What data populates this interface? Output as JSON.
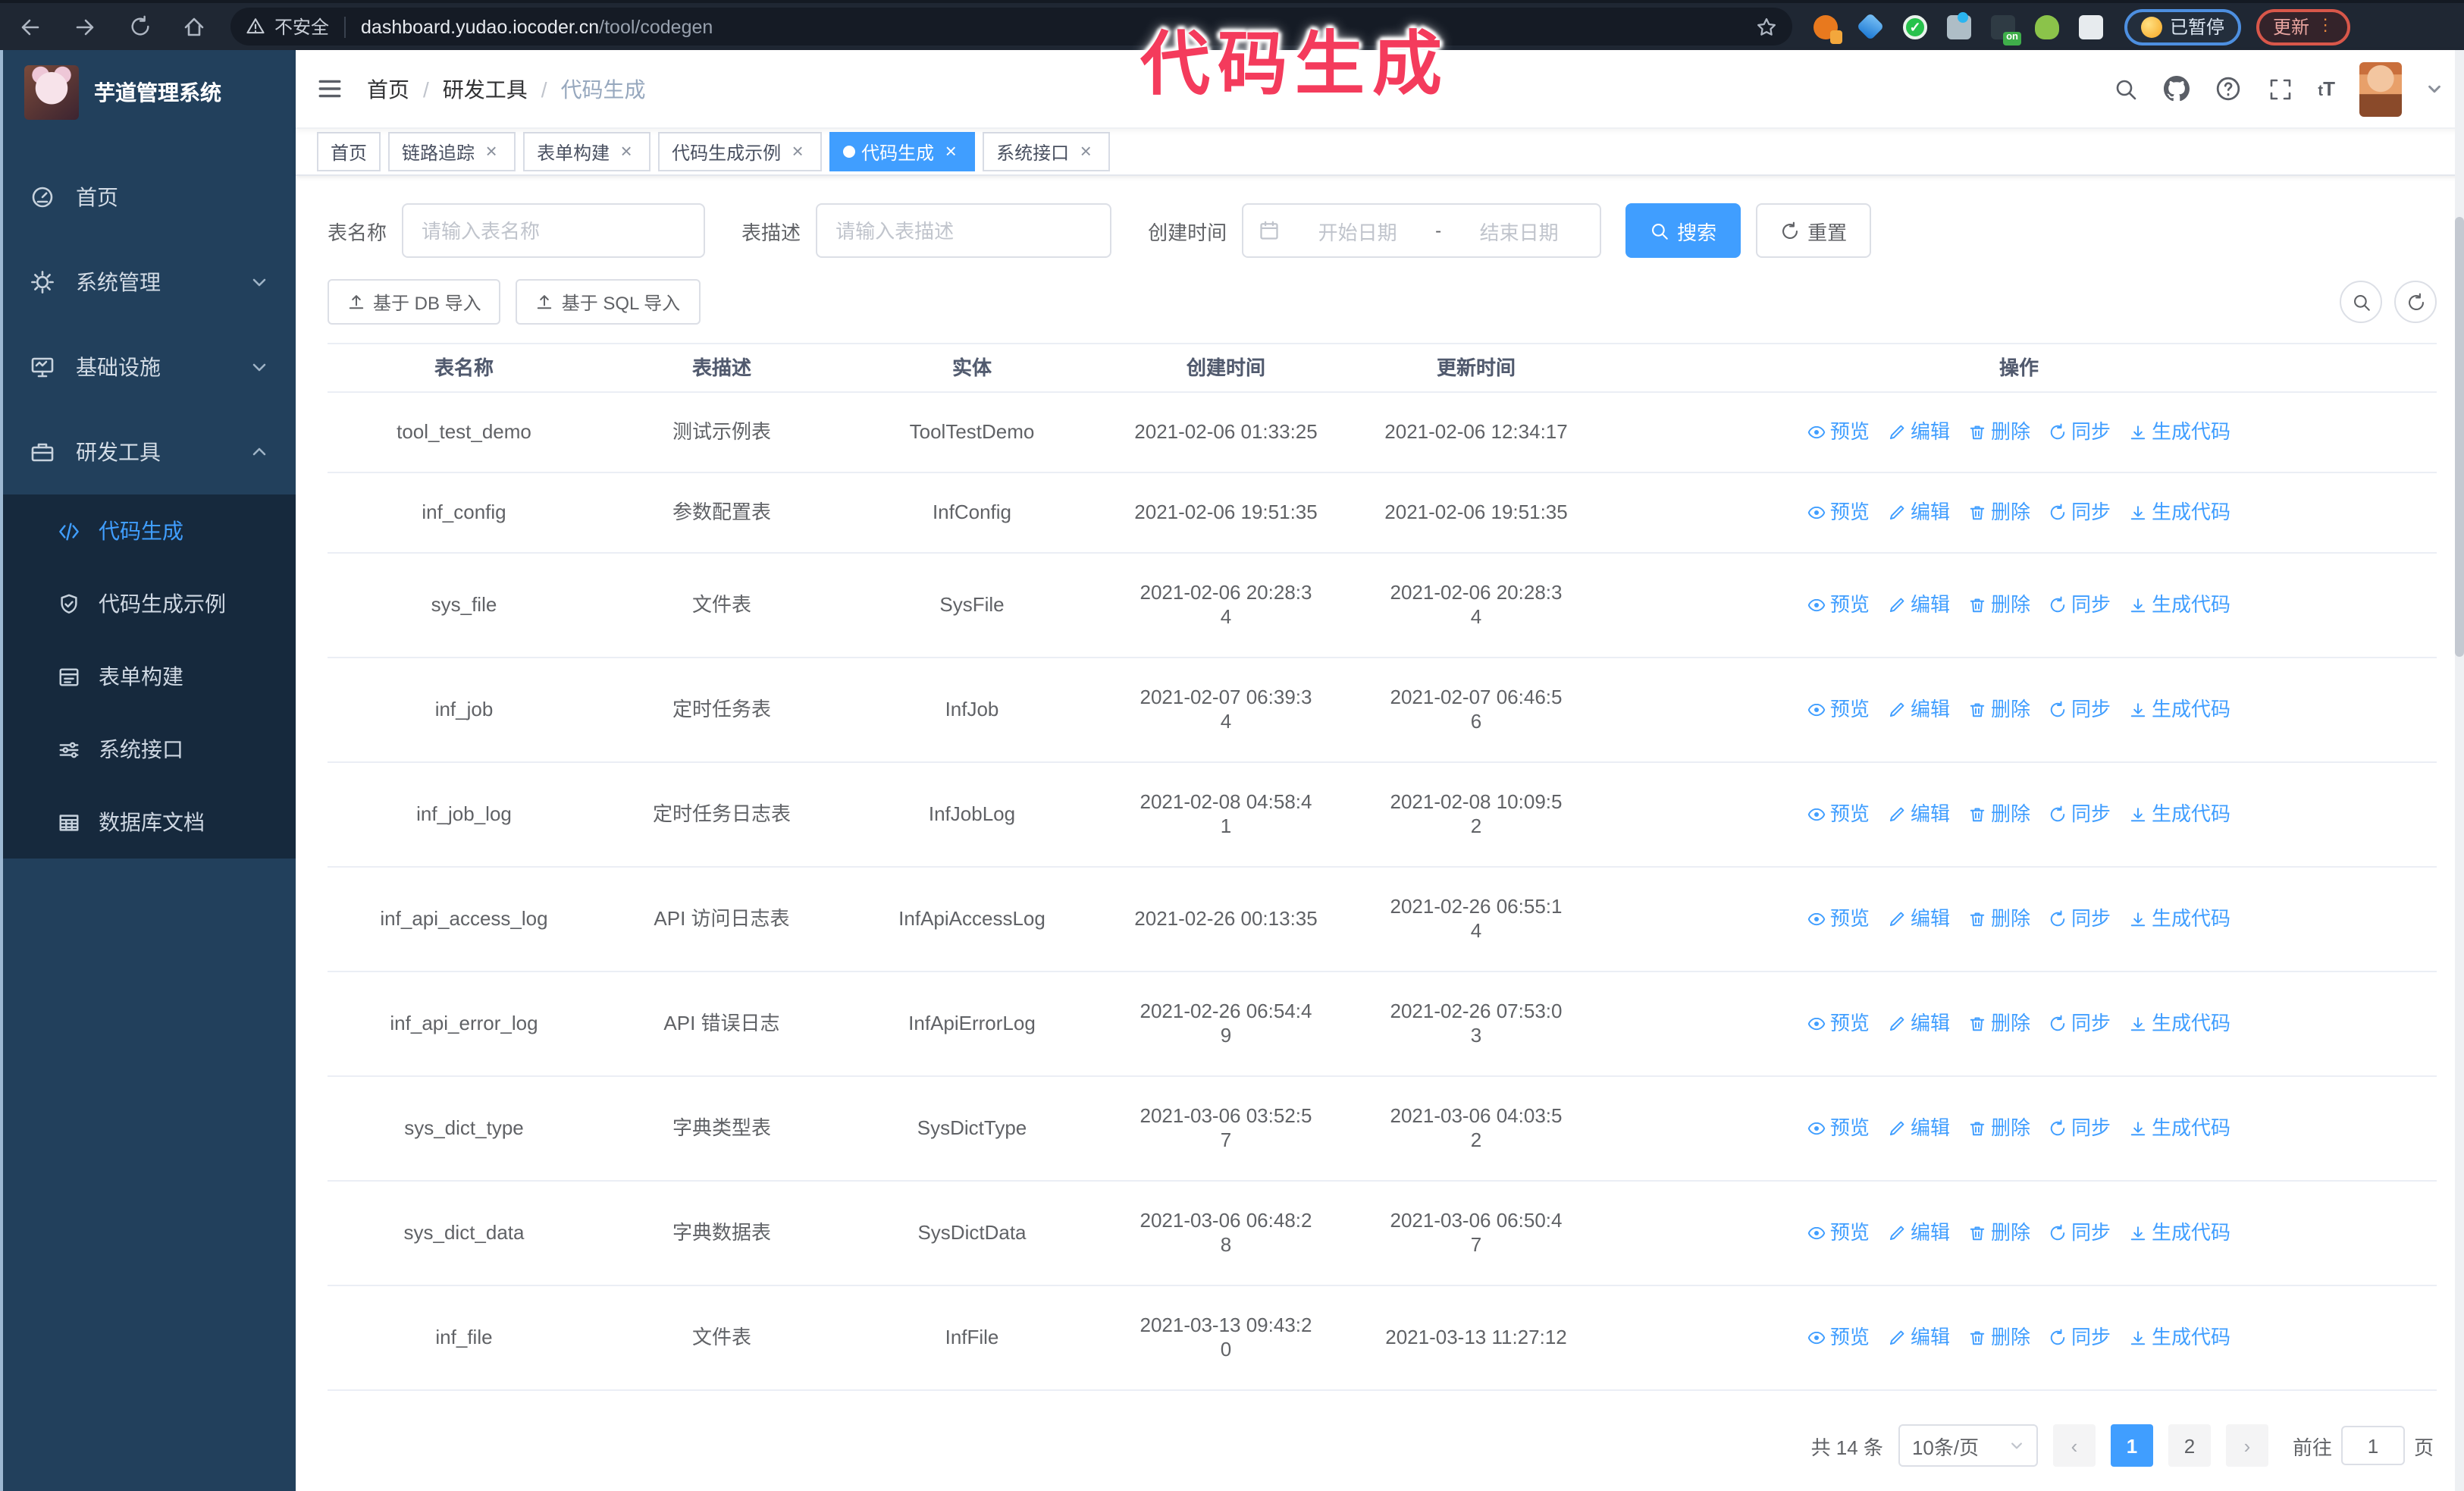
{
  "annotation": {
    "text": "代码生成",
    "color": "#f43b5c"
  },
  "browser": {
    "security_label": "不安全",
    "url_domain": "dashboard.yudao.iocoder.cn",
    "url_path": "/tool/codegen",
    "profile_chip_label": "已暂停",
    "update_button_label": "更新",
    "extension_badge": "on"
  },
  "sidebar": {
    "logo_title": "芋道管理系统",
    "items": [
      {
        "label": "首页",
        "icon": "dashboard-icon",
        "state": "none"
      },
      {
        "label": "系统管理",
        "icon": "gear-icon",
        "state": "collapsed"
      },
      {
        "label": "基础设施",
        "icon": "monitor-icon",
        "state": "collapsed"
      },
      {
        "label": "研发工具",
        "icon": "toolbox-icon",
        "state": "expanded"
      }
    ],
    "sub_items": [
      {
        "label": "代码生成",
        "icon": "code-icon",
        "active": true
      },
      {
        "label": "代码生成示例",
        "icon": "shield-check-icon",
        "active": false
      },
      {
        "label": "表单构建",
        "icon": "form-icon",
        "active": false
      },
      {
        "label": "系统接口",
        "icon": "sliders-icon",
        "active": false
      },
      {
        "label": "数据库文档",
        "icon": "database-icon",
        "active": false
      }
    ]
  },
  "header": {
    "breadcrumb": [
      "首页",
      "研发工具",
      "代码生成"
    ]
  },
  "tabs": [
    {
      "label": "首页",
      "closable": false,
      "active": false
    },
    {
      "label": "链路追踪",
      "closable": true,
      "active": false
    },
    {
      "label": "表单构建",
      "closable": true,
      "active": false
    },
    {
      "label": "代码生成示例",
      "closable": true,
      "active": false
    },
    {
      "label": "代码生成",
      "closable": true,
      "active": true
    },
    {
      "label": "系统接口",
      "closable": true,
      "active": false
    }
  ],
  "filters": {
    "table_name_label": "表名称",
    "table_name_placeholder": "请输入表名称",
    "table_desc_label": "表描述",
    "table_desc_placeholder": "请输入表描述",
    "create_time_label": "创建时间",
    "start_placeholder": "开始日期",
    "range_separator": "-",
    "end_placeholder": "结束日期",
    "search_label": "搜索",
    "reset_label": "重置"
  },
  "toolbar": {
    "db_import_label": "基于 DB 导入",
    "sql_import_label": "基于 SQL 导入"
  },
  "table": {
    "headers": [
      "表名称",
      "表描述",
      "实体",
      "创建时间",
      "更新时间",
      "操作"
    ],
    "action_labels": [
      "预览",
      "编辑",
      "删除",
      "同步",
      "生成代码"
    ],
    "rows": [
      {
        "name": "tool_test_demo",
        "desc": "测试示例表",
        "entity": "ToolTestDemo",
        "created": "2021-02-06 01:33:25",
        "updated": "2021-02-06 12:34:17"
      },
      {
        "name": "inf_config",
        "desc": "参数配置表",
        "entity": "InfConfig",
        "created": "2021-02-06 19:51:35",
        "updated": "2021-02-06 19:51:35"
      },
      {
        "name": "sys_file",
        "desc": "文件表",
        "entity": "SysFile",
        "created": "2021-02-06 20:28:3\n4",
        "updated": "2021-02-06 20:28:3\n4"
      },
      {
        "name": "inf_job",
        "desc": "定时任务表",
        "entity": "InfJob",
        "created": "2021-02-07 06:39:3\n4",
        "updated": "2021-02-07 06:46:5\n6"
      },
      {
        "name": "inf_job_log",
        "desc": "定时任务日志表",
        "entity": "InfJobLog",
        "created": "2021-02-08 04:58:4\n1",
        "updated": "2021-02-08 10:09:5\n2"
      },
      {
        "name": "inf_api_access_log",
        "desc": "API 访问日志表",
        "entity": "InfApiAccessLog",
        "created": "2021-02-26 00:13:35",
        "updated": "2021-02-26 06:55:1\n4"
      },
      {
        "name": "inf_api_error_log",
        "desc": "API 错误日志",
        "entity": "InfApiErrorLog",
        "created": "2021-02-26 06:54:4\n9",
        "updated": "2021-02-26 07:53:0\n3"
      },
      {
        "name": "sys_dict_type",
        "desc": "字典类型表",
        "entity": "SysDictType",
        "created": "2021-03-06 03:52:5\n7",
        "updated": "2021-03-06 04:03:5\n2"
      },
      {
        "name": "sys_dict_data",
        "desc": "字典数据表",
        "entity": "SysDictData",
        "created": "2021-03-06 06:48:2\n8",
        "updated": "2021-03-06 06:50:4\n7"
      },
      {
        "name": "inf_file",
        "desc": "文件表",
        "entity": "InfFile",
        "created": "2021-03-13 09:43:2\n0",
        "updated": "2021-03-13 11:27:12"
      }
    ]
  },
  "pagination": {
    "total_label": "共 14 条",
    "page_size_label": "10条/页",
    "pages": [
      "1",
      "2"
    ],
    "active_page": "1",
    "goto_label": "前往",
    "goto_value": "1",
    "unit_label": "页"
  },
  "ui": {
    "close_glyph": "×",
    "breadcrumb_separator": "/",
    "prev_glyph": "‹",
    "next_glyph": "›",
    "textsize_glyph": "tT",
    "ellipsis_glyph": "⋮"
  },
  "colors": {
    "accent": "#409eff",
    "annotation": "#f43b5c",
    "sidebar_bg": "#22405c",
    "submenu_bg": "#16293d",
    "chrome_bg": "#1f2733",
    "update_chip_border": "#d8574a",
    "profile_chip_border": "#4d8fe0"
  }
}
